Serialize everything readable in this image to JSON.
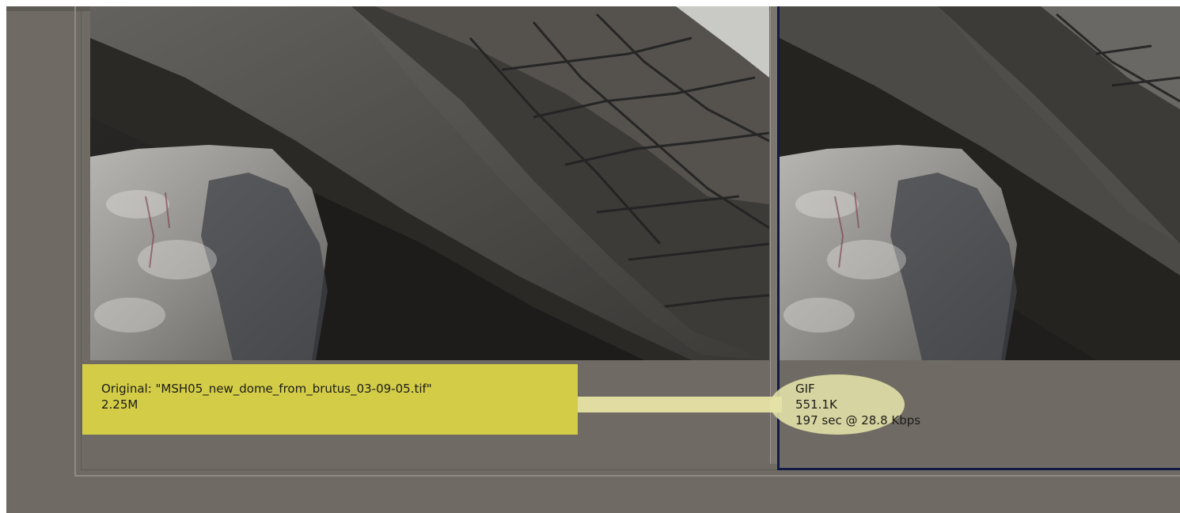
{
  "original_panel": {
    "label": "Original: \"MSH05_new_dome_from_brutus_03-09-05.tif\"",
    "size": "2.25M"
  },
  "optimized_panel": {
    "format": "GIF",
    "size": "551.1K",
    "download_time": "197 sec @ 28.8 Kbps"
  },
  "colors": {
    "background": "#6f6b64",
    "selected_border": "#101a45",
    "highlight_yellow": "#e9e241",
    "highlight_pale": "#e5e2a8"
  }
}
